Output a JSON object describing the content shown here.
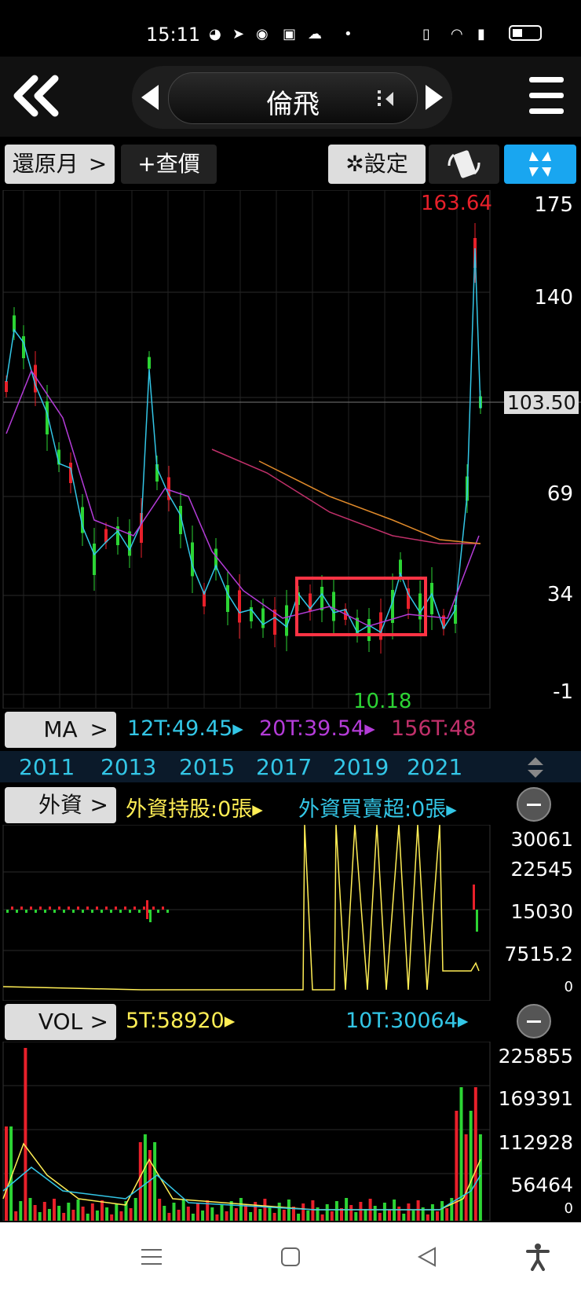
{
  "status_bar": {
    "time": "15:11"
  },
  "header": {
    "stock_name": "倫飛"
  },
  "toolbar": {
    "period_button": "還原月",
    "period_chevron": ">",
    "quote_button": "+查價",
    "settings_button": "設定"
  },
  "main_chart": {
    "high_label": "163.64",
    "low_label": "10.18",
    "current_price": "103.50",
    "y_ticks": [
      "175",
      "140",
      "69",
      "34",
      "-1"
    ],
    "x_years": [
      "2011",
      "2013",
      "2015",
      "2017",
      "2019",
      "2021"
    ]
  },
  "ma_bar": {
    "button": "MA",
    "chevron": ">",
    "ma12": "12T:49.45",
    "ma20": "20T:39.54",
    "ma156": "156T:48"
  },
  "foreign_bar": {
    "button": "外資",
    "chevron": ">",
    "holding": "外資持股:0張",
    "net": "外資買賣超:0張",
    "y_ticks": [
      "30061",
      "22545",
      "15030",
      "7515.2",
      "0"
    ]
  },
  "vol_bar": {
    "button": "VOL",
    "chevron": ">",
    "ma5": "5T:58920",
    "ma10": "10T:30064",
    "y_ticks": [
      "225855",
      "169391",
      "112928",
      "56464",
      "0"
    ]
  },
  "colors": {
    "up": "#e8202a",
    "down": "#2cd434",
    "ma12": "#33c6e6",
    "ma20": "#b43cd8",
    "ma156": "#c0306a",
    "accent": "#19a6f0",
    "yellow": "#ffee55"
  }
}
